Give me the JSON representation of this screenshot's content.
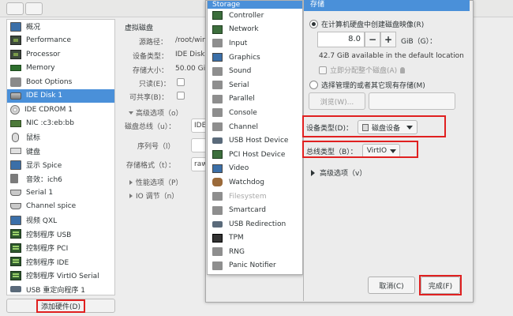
{
  "hardware_list": {
    "items": [
      {
        "label": "概况",
        "icon": "overview-icon"
      },
      {
        "label": "Performance",
        "icon": "performance-icon"
      },
      {
        "label": "Processor",
        "icon": "processor-icon"
      },
      {
        "label": "Memory",
        "icon": "memory-icon"
      },
      {
        "label": "Boot Options",
        "icon": "boot-icon"
      },
      {
        "label": "IDE Disk 1",
        "icon": "disk-icon",
        "selected": true
      },
      {
        "label": "IDE CDROM 1",
        "icon": "cdrom-icon"
      },
      {
        "label": "NIC :c3:eb:bb",
        "icon": "nic-icon"
      },
      {
        "label": "鼠标",
        "icon": "mouse-icon"
      },
      {
        "label": "键盘",
        "icon": "keyboard-icon"
      },
      {
        "label": "显示 Spice",
        "icon": "display-icon"
      },
      {
        "label": "音效：ich6",
        "icon": "sound-icon"
      },
      {
        "label": "Serial 1",
        "icon": "serial-icon"
      },
      {
        "label": "Channel spice",
        "icon": "channel-icon"
      },
      {
        "label": "视频 QXL",
        "icon": "video-icon"
      },
      {
        "label": "控制程序 USB",
        "icon": "controller-icon"
      },
      {
        "label": "控制程序 PCI",
        "icon": "controller-icon"
      },
      {
        "label": "控制程序 IDE",
        "icon": "controller-icon"
      },
      {
        "label": "控制程序 VirtIO Serial",
        "icon": "controller-icon"
      },
      {
        "label": "USB 重定向程序 1",
        "icon": "usb-icon"
      }
    ],
    "add_hardware_label": "添加硬件(D)"
  },
  "disk_details": {
    "section_title": "虚拟磁盘",
    "source_path_label": "源路径：",
    "source_path_value": "/root/win",
    "device_type_label": "设备类型：",
    "device_type_value": "IDE Disk",
    "storage_size_label": "存储大小：",
    "storage_size_value": "50.00 Gi",
    "readonly_label": "只读(E)：",
    "shareable_label": "可共享(B)：",
    "advanced_label": "高级选项（o）",
    "disk_bus_label": "磁盘总线（u）：",
    "disk_bus_value": "IDE",
    "serial_label": "序列号（l）",
    "storage_format_label": "存储格式（t）：",
    "storage_format_value": "raw",
    "performance_label": "性能选项（P）",
    "io_label": "IO 调节（n）"
  },
  "device_menu": {
    "items": [
      {
        "label": "Storage",
        "icon": "storage-icon",
        "highlight": true
      },
      {
        "label": "Controller",
        "icon": "controller-icon"
      },
      {
        "label": "Network",
        "icon": "network-icon"
      },
      {
        "label": "Input",
        "icon": "input-icon"
      },
      {
        "label": "Graphics",
        "icon": "graphics-icon"
      },
      {
        "label": "Sound",
        "icon": "sound-icon"
      },
      {
        "label": "Serial",
        "icon": "serial-icon"
      },
      {
        "label": "Parallel",
        "icon": "parallel-icon"
      },
      {
        "label": "Console",
        "icon": "console-icon"
      },
      {
        "label": "Channel",
        "icon": "channel-icon"
      },
      {
        "label": "USB Host Device",
        "icon": "usb-icon"
      },
      {
        "label": "PCI Host Device",
        "icon": "pci-icon"
      },
      {
        "label": "Video",
        "icon": "video-icon"
      },
      {
        "label": "Watchdog",
        "icon": "watchdog-icon"
      },
      {
        "label": "Filesystem",
        "icon": "filesystem-icon",
        "disabled": true
      },
      {
        "label": "Smartcard",
        "icon": "smartcard-icon"
      },
      {
        "label": "USB Redirection",
        "icon": "usb-redirection-icon"
      },
      {
        "label": "TPM",
        "icon": "tpm-icon"
      },
      {
        "label": "RNG",
        "icon": "rng-icon"
      },
      {
        "label": "Panic Notifier",
        "icon": "panic-icon"
      }
    ]
  },
  "storage_panel": {
    "title": "存储",
    "create_disk_label": "在计算机硬盘中创建磁盘映像(R)",
    "size_value": "8.0",
    "size_unit_label": "GiB（G）：",
    "available_text": "42.7 GiB available in the default location",
    "allocate_label": "立即分配整个磁盘(A)",
    "select_existing_label": "选择管理的或者其它现有存储(M)",
    "browse_label": "浏览(W)...",
    "device_type_label": "设备类型(D)：",
    "device_type_value": "磁盘设备",
    "bus_type_label": "总线类型（B）：",
    "bus_type_value": "VirtIO",
    "advanced_label": "高级选项（v）",
    "cancel_label": "取消(C)",
    "finish_label": "完成(F)"
  },
  "colors": {
    "selection": "#4a90d9",
    "annotation_red": "#e02020"
  }
}
